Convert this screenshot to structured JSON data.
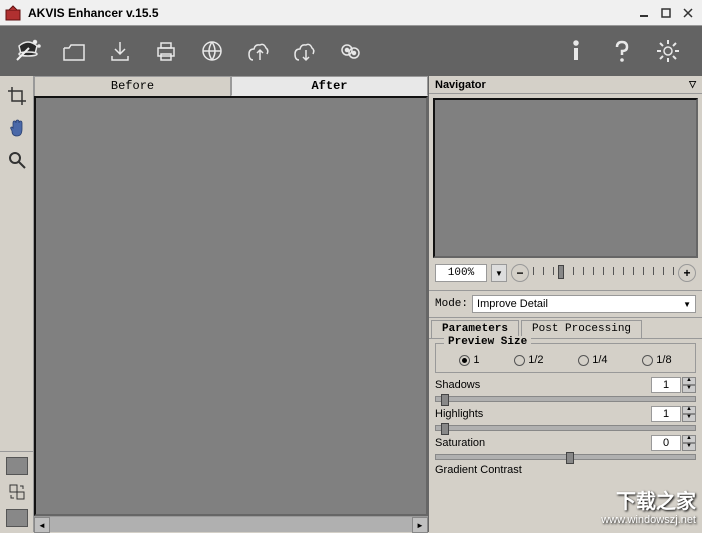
{
  "window": {
    "title": "AKVIS Enhancer v.15.5"
  },
  "tabs": {
    "before": "Before",
    "after": "After"
  },
  "navigator": {
    "title": "Navigator",
    "zoom": "100%"
  },
  "mode": {
    "label": "Mode:",
    "value": "Improve Detail"
  },
  "param_tabs": {
    "parameters": "Parameters",
    "post": "Post Processing"
  },
  "preview": {
    "legend": "Preview Size",
    "opts": [
      "1",
      "1/2",
      "1/4",
      "1/8"
    ],
    "selected": 0
  },
  "params": {
    "shadows": {
      "label": "Shadows",
      "value": "1"
    },
    "highlights": {
      "label": "Highlights",
      "value": "1"
    },
    "saturation": {
      "label": "Saturation",
      "value": "0"
    },
    "gradient": {
      "label": "Gradient Contrast"
    }
  },
  "watermark": {
    "cn": "下载之家",
    "url": "www.windowszj.net"
  }
}
